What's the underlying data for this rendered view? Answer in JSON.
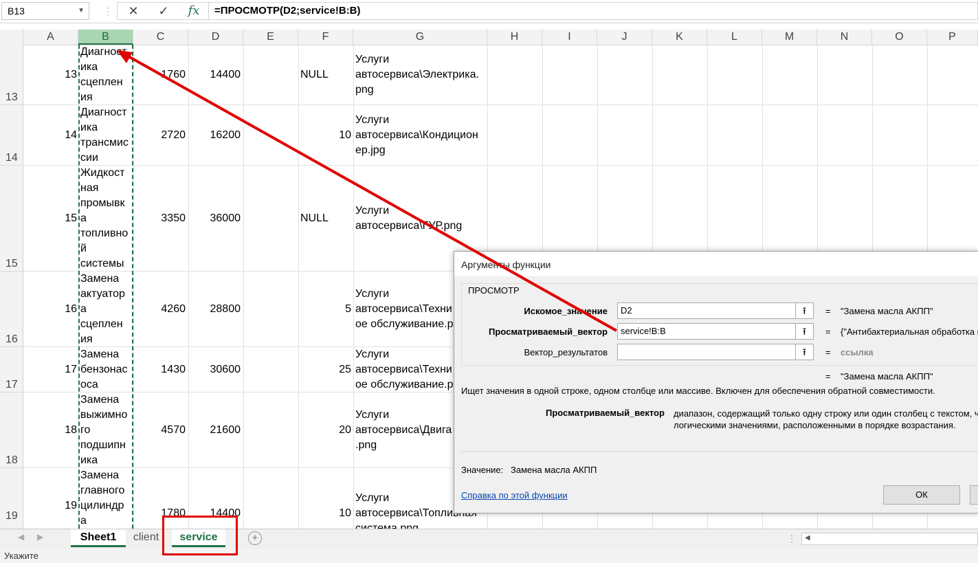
{
  "formula_bar": {
    "name_box": "B13",
    "cancel_icon": "✕",
    "enter_icon": "✓",
    "fx_icon": "fx",
    "formula": "=ПРОСМОТР(D2;service!B:B)"
  },
  "columns": [
    "A",
    "B",
    "C",
    "D",
    "E",
    "F",
    "G",
    "H",
    "I",
    "J",
    "K",
    "L",
    "M",
    "N",
    "O",
    "P"
  ],
  "rows": [
    {
      "num": "13",
      "a": "13",
      "b": "Диагност ика сцеплен ия",
      "c": "1760",
      "d": "14400",
      "f": "NULL",
      "g": "Услуги автосервиса\\Электрика.png"
    },
    {
      "num": "14",
      "a": "14",
      "b": "Диагност ика трансмис сии",
      "c": "2720",
      "d": "16200",
      "f": "10",
      "g": "Услуги автосервиса\\Кондицион ер.jpg"
    },
    {
      "num": "15",
      "a": "15",
      "b": "Жидкост ная промывк а топливно й системы",
      "c": "3350",
      "d": "36000",
      "f": "NULL",
      "g": "Услуги автосервиса\\ГУР.png"
    },
    {
      "num": "16",
      "a": "16",
      "b": "Замена актуатор а сцеплен ия",
      "c": "4260",
      "d": "28800",
      "f": "5",
      "g": "Услуги автосервиса\\Техни ое обслуживание.p"
    },
    {
      "num": "17",
      "a": "17",
      "b": "Замена бензонас оса",
      "c": "1430",
      "d": "30600",
      "f": "25",
      "g": "Услуги автосервиса\\Техни ое обслуживание.p"
    },
    {
      "num": "18",
      "a": "18",
      "b": "Замена выжимно го подшипн ика",
      "c": "4570",
      "d": "21600",
      "f": "20",
      "g": "Услуги автосервиса\\Двига .png"
    },
    {
      "num": "19",
      "a": "19",
      "b": "Замена главного цилиндр а",
      "c": "1780",
      "d": "14400",
      "f": "10",
      "g": "Услуги автосервиса\\Топливная система.png"
    }
  ],
  "b_lines": {
    "r13": [
      "Диагност",
      "ика",
      "сцеплен",
      "ия"
    ],
    "r14": [
      "Диагност",
      "ика",
      "трансмис",
      "сии"
    ],
    "r15": [
      "Жидкост",
      "ная",
      "промывк",
      "а",
      "топливно",
      "й",
      "системы"
    ],
    "r16": [
      "Замена",
      "актуатор",
      "а",
      "сцеплен",
      "ия"
    ],
    "r17": [
      "Замена",
      "бензонас",
      "оса"
    ],
    "r18": [
      "Замена",
      "выжимно",
      "го",
      "подшипн",
      "ика"
    ],
    "r19": [
      "Замена",
      "главного",
      "цилиндр",
      "а"
    ]
  },
  "g_lines": {
    "r13": [
      "Услуги",
      "автосервиса\\Электрика.",
      "png"
    ],
    "r14": [
      "Услуги",
      "автосервиса\\Кондицион",
      "ер.jpg"
    ],
    "r15": [
      "Услуги",
      "автосервиса\\ГУР.png"
    ],
    "r16": [
      "Услуги",
      "автосервиса\\Техни",
      "ое обслуживание.р"
    ],
    "r17": [
      "Услуги",
      "автосервиса\\Техни",
      "ое обслуживание.р"
    ],
    "r18": [
      "Услуги",
      "автосервиса\\Двига",
      ".png"
    ],
    "r19": [
      "Услуги",
      "автосервиса\\Топливная",
      "система.png"
    ]
  },
  "sheet_tabs": {
    "sheet1": "Sheet1",
    "client": "client",
    "service": "service",
    "add_icon": "+"
  },
  "status": "Укажите",
  "dialog": {
    "title": "Аргументы функции",
    "group": "ПРОСМОТР",
    "arg1_label": "Искомое_значение",
    "arg1_value": "D2",
    "arg1_result": "\"Замена масла АКПП\"",
    "arg2_label": "Просматриваемый_вектор",
    "arg2_value": "service!B:B",
    "arg2_result": "{\"Антибактериальная обработка к",
    "arg3_label": "Вектор_результатов",
    "arg3_value": "",
    "arg3_result": "ссылка",
    "eq": "=",
    "total_result": "\"Замена масла АКПП\"",
    "description": "Ищет значения в одной строке, одном столбце или массиве. Включен для обеспечения обратной совместимости.",
    "argname": "Просматриваемый_вектор",
    "argdesc_1": "диапазон, содержащий только одну строку или один столбец с текстом, ч",
    "argdesc_2": "логическими значениями, расположенными в порядке возрастания.",
    "value_label": "Значение:",
    "value": "Замена масла АКПП",
    "help_link": "Справка по этой функции",
    "ok": "ОК",
    "collapse_icon": "⭱"
  },
  "colors": {
    "accent": "#217346",
    "annotation": "#e00000"
  }
}
